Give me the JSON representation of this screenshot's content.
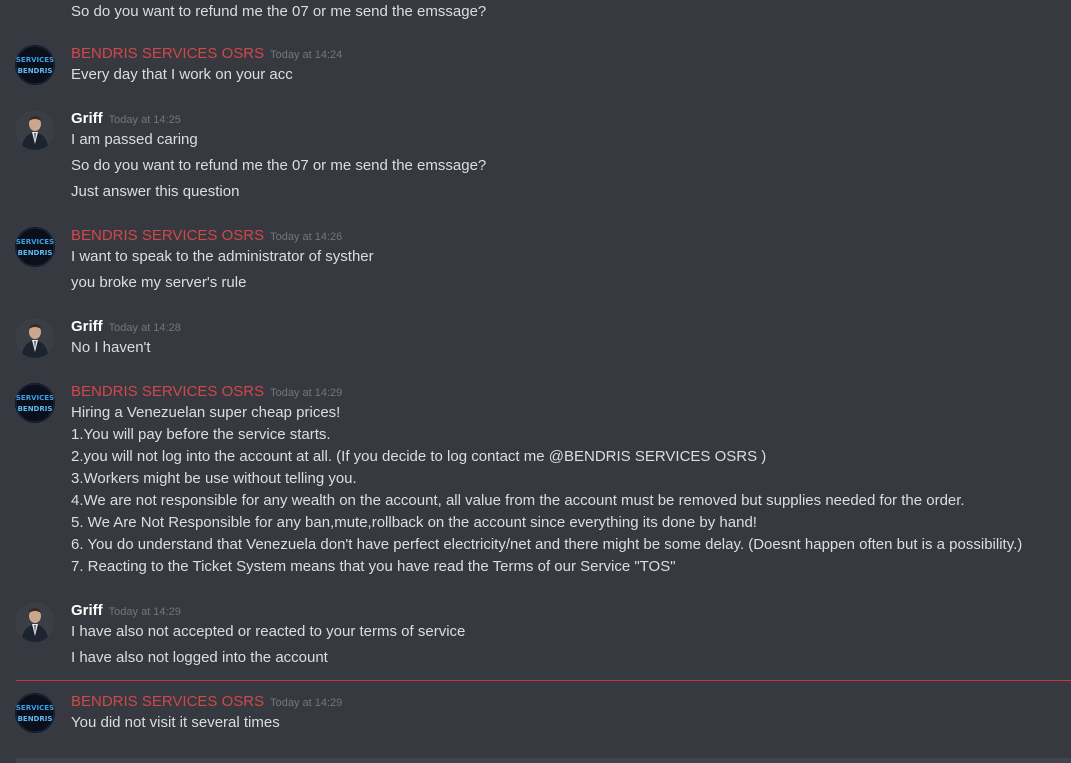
{
  "messages": [
    {
      "author": "",
      "time": "",
      "lines": [
        "So do you want to refund me the 07 or me send the emssage?"
      ]
    },
    {
      "author": "BENDRIS SERVICES OSRS",
      "time": "Today at 14:24",
      "lines": [
        "Every day that I work on your acc"
      ]
    },
    {
      "author": "Griff",
      "time": "Today at 14:25",
      "lines": [
        "I am passed caring",
        "So do you want to refund me the 07 or me send the emssage?",
        "Just answer this question"
      ]
    },
    {
      "author": "BENDRIS SERVICES OSRS",
      "time": "Today at 14:26",
      "lines": [
        "I want to speak to the administrator of systher",
        "you broke my server's rule"
      ]
    },
    {
      "author": "Griff",
      "time": "Today at 14:28",
      "lines": [
        "No I haven't"
      ]
    },
    {
      "author": "BENDRIS SERVICES OSRS",
      "time": "Today at 14:29",
      "lines": [
        "Hiring a Venezuelan super cheap prices!",
        "1.You will pay before the service starts.",
        "2.you will not log into the account at all. (If you decide to log contact me  @BENDRIS SERVICES OSRS )",
        "3.Workers might be use without telling you.",
        "4.We are not responsible for any wealth on the account, all value from the account must be removed but supplies needed for the order.",
        "5. We Are Not Responsible for any ban,mute,rollback on the account since everything its done by hand!",
        "6. You do understand that Venezuela don't have perfect electricity/net and there might be some delay. (Doesnt happen often but is a possibility.)",
        "7. Reacting to the Ticket System means that you have read the Terms of our Service \"TOS\""
      ]
    },
    {
      "author": "Griff",
      "time": "Today at 14:29",
      "lines": [
        "I have also not accepted or reacted to your terms of service",
        "I have also not logged into the account"
      ]
    },
    {
      "author": "BENDRIS SERVICES OSRS",
      "time": "Today at 14:29",
      "lines": [
        "You did not visit it several times"
      ]
    }
  ],
  "avatars": {
    "bendris_label_top": "SERVICES",
    "bendris_label_bottom": "BENDRIS"
  },
  "colors": {
    "background": "#36393f",
    "bendris_name": "#d04848",
    "griff_name": "#ffffff",
    "timestamp": "#72767d",
    "text": "#dcddde",
    "new_divider": "#c0393e"
  }
}
